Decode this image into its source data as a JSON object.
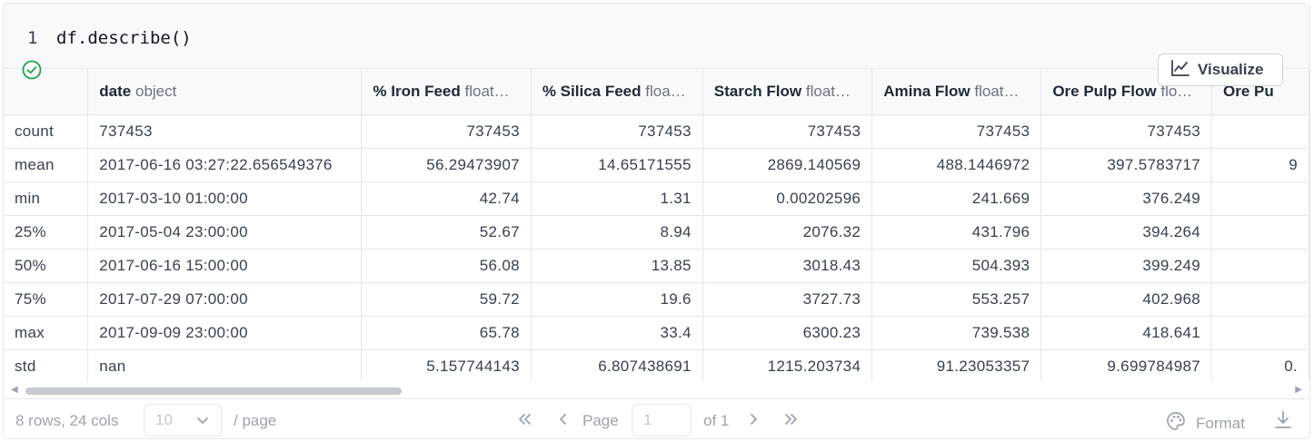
{
  "code_cell": {
    "line_number": "1",
    "source": "df.describe()"
  },
  "visualize_button": {
    "label": "Visualize"
  },
  "table": {
    "columns": [
      {
        "name": "",
        "dtype": ""
      },
      {
        "name": "date",
        "dtype": "object"
      },
      {
        "name": "% Iron Feed",
        "dtype": "float…"
      },
      {
        "name": "% Silica Feed",
        "dtype": "floa…"
      },
      {
        "name": "Starch Flow",
        "dtype": "float…"
      },
      {
        "name": "Amina Flow",
        "dtype": "float…"
      },
      {
        "name": "Ore Pulp Flow",
        "dtype": "flo…"
      },
      {
        "name": "Ore Pu",
        "dtype": ""
      }
    ],
    "rows": [
      {
        "stat": "count",
        "cells": [
          "737453",
          "737453",
          "737453",
          "737453",
          "737453",
          "737453",
          ""
        ]
      },
      {
        "stat": "mean",
        "cells": [
          "2017-06-16 03:27:22.656549376",
          "56.29473907",
          "14.65171555",
          "2869.140569",
          "488.1446972",
          "397.5783717",
          "9"
        ]
      },
      {
        "stat": "min",
        "cells": [
          "2017-03-10 01:00:00",
          "42.74",
          "1.31",
          "0.00202596",
          "241.669",
          "376.249",
          ""
        ]
      },
      {
        "stat": "25%",
        "cells": [
          "2017-05-04 23:00:00",
          "52.67",
          "8.94",
          "2076.32",
          "431.796",
          "394.264",
          ""
        ]
      },
      {
        "stat": "50%",
        "cells": [
          "2017-06-16 15:00:00",
          "56.08",
          "13.85",
          "3018.43",
          "504.393",
          "399.249",
          ""
        ]
      },
      {
        "stat": "75%",
        "cells": [
          "2017-07-29 07:00:00",
          "59.72",
          "19.6",
          "3727.73",
          "553.257",
          "402.968",
          ""
        ]
      },
      {
        "stat": "max",
        "cells": [
          "2017-09-09 23:00:00",
          "65.78",
          "33.4",
          "6300.23",
          "739.538",
          "418.641",
          ""
        ]
      },
      {
        "stat": "std",
        "cells": [
          "nan",
          "5.157744143",
          "6.807438691",
          "1215.203734",
          "91.23053357",
          "9.699784987",
          "0."
        ]
      }
    ]
  },
  "footer": {
    "summary": "8 rows, 24 cols",
    "page_size": "10",
    "per_page": "/ page",
    "page_label": "Page",
    "page_value": "1",
    "of_label": "of 1",
    "format_label": "Format"
  },
  "colors": {
    "success": "#16a34a",
    "border": "#e5e7eb",
    "header_bg": "#f9fafb",
    "code_bg": "#f8f9fa"
  }
}
